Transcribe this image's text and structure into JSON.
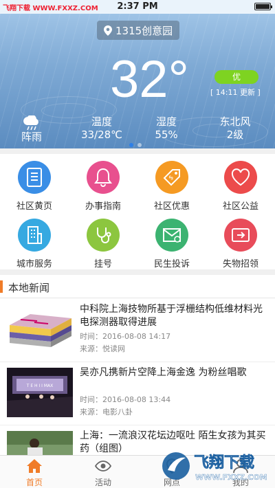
{
  "status_bar": {
    "carrier": "飞翔下载 WWW.FXXZ.COM",
    "time": "2:37 PM"
  },
  "weather": {
    "location": "1315创意园",
    "temperature": "32°",
    "aqi": "优",
    "updated": "[ 14:11 更新 ]",
    "columns": [
      {
        "label": "",
        "value": "阵雨",
        "icon": "cloud-rain-icon"
      },
      {
        "label": "温度",
        "value": "33/28℃"
      },
      {
        "label": "湿度",
        "value": "55%"
      },
      {
        "label": "东北风",
        "value": "2级"
      }
    ]
  },
  "services": [
    {
      "label": "社区黄页",
      "icon": "document-icon",
      "color": "#3a8ee6"
    },
    {
      "label": "办事指南",
      "icon": "bell-icon",
      "color": "#e8508e"
    },
    {
      "label": "社区优惠",
      "icon": "price-tag-icon",
      "color": "#f59a23"
    },
    {
      "label": "社区公益",
      "icon": "heart-icon",
      "color": "#ec4b4b"
    },
    {
      "label": "城市服务",
      "icon": "building-icon",
      "color": "#36a9e1"
    },
    {
      "label": "挂号",
      "icon": "stethoscope-icon",
      "color": "#8cc63f"
    },
    {
      "label": "民生投诉",
      "icon": "mail-icon",
      "color": "#3cb371"
    },
    {
      "label": "失物招领",
      "icon": "transfer-card-icon",
      "color": "#e84c5a"
    }
  ],
  "news": {
    "heading": "本地新闻",
    "items": [
      {
        "title": "中科院上海技物所基于浮栅结构低维材料光电探测器取得进展",
        "time": "时间：2016-08-08 14:17",
        "source": "来源：悦读网"
      },
      {
        "title": "吴亦凡携新片空降上海金逸 为粉丝唱歌",
        "time": "时间：2016-08-08 13:44",
        "source": "来源：电影八卦"
      },
      {
        "title": "上海：一流浪汉花坛边呕吐 陌生女孩为其买药（组图）",
        "time": "",
        "source": ""
      }
    ]
  },
  "tabbar": [
    {
      "label": "首页",
      "icon": "home-icon",
      "active": true
    },
    {
      "label": "活动",
      "icon": "eye-icon",
      "active": false
    },
    {
      "label": "网点",
      "icon": "location-icon",
      "active": false
    },
    {
      "label": "我的",
      "icon": "user-icon",
      "active": false
    }
  ],
  "watermark": {
    "brand": "飞翔下载",
    "url": "WWW.FXXZ.COM"
  },
  "colors": {
    "accent": "#f07c28",
    "aqi_good": "#7ed321",
    "page_indicator": "#2d7fe8"
  }
}
